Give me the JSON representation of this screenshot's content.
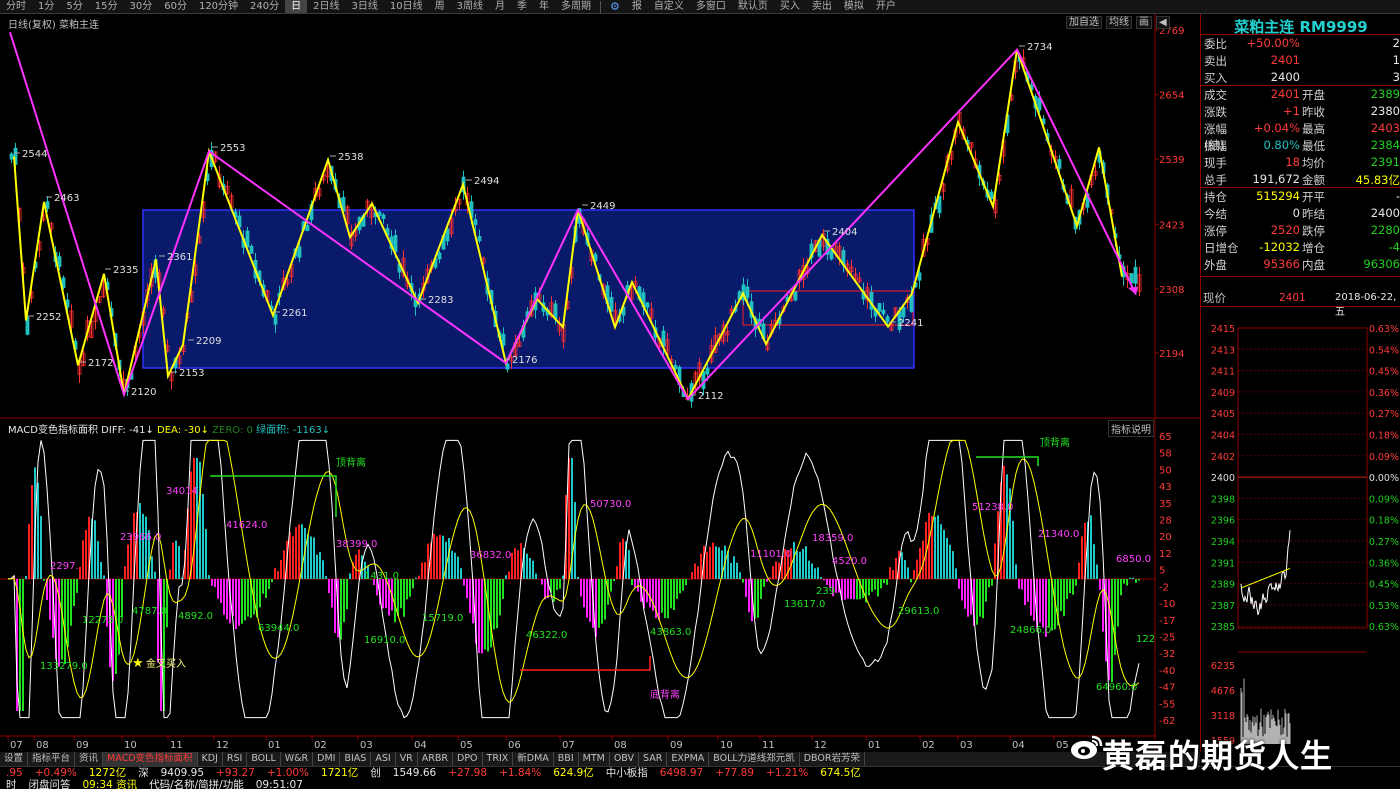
{
  "toolbar": {
    "periods": [
      "分时",
      "1分",
      "5分",
      "15分",
      "30分",
      "60分",
      "120分钟",
      "240分",
      "日",
      "2日线",
      "3日线",
      "10日线",
      "周",
      "3周线",
      "月",
      "季",
      "年",
      "多周期"
    ],
    "active_period": "日",
    "extra": [
      "报",
      "自定义",
      "多窗口",
      "默认页",
      "买入",
      "卖出",
      "模拟",
      "开户"
    ]
  },
  "main_chart": {
    "title": "日线(复权)  菜粕主连",
    "buttons": [
      "加自选",
      "均线",
      "画",
      "◀"
    ],
    "price_axis": [
      "2769",
      "2654",
      "2539",
      "2423",
      "2308",
      "2194"
    ],
    "swing_labels": [
      "2544",
      "2463",
      "2252",
      "2172",
      "2335",
      "2120",
      "2361",
      "2153",
      "2209",
      "2553",
      "2261",
      "2538",
      "2283",
      "2494",
      "2176",
      "2449",
      "2112",
      "2404",
      "2241",
      "2734"
    ],
    "colors": {
      "zigzag": "#ffff00",
      "trend": "#ff33ff",
      "box_fill": "#0a1a6a",
      "box_border": "#3030ff",
      "up": "#ff3030",
      "down": "#20c0c0"
    }
  },
  "macd": {
    "title_name": "MACD变色指标面积",
    "diff_label": "DIFF: -41",
    "dea_label": "DEA: -30",
    "zero_label": "ZERO: 0",
    "area_label": "绿面积: -1163",
    "help_button": "指标说明",
    "axis": [
      "65",
      "58",
      "50",
      "43",
      "35",
      "28",
      "20",
      "12",
      "5",
      "-2",
      "-10",
      "-17",
      "-25",
      "-32",
      "-40",
      "-47",
      "-55",
      "-62"
    ],
    "area_values_red": [
      "2297.",
      "34014.",
      "23966.0",
      "41624.0",
      "38399.0",
      "50730.0",
      "36832.0",
      "11101.0",
      "18359.0",
      "4520.0",
      "51238.0",
      "21340.0",
      "6850.0"
    ],
    "area_values_green": [
      "133279.0",
      "12273.0",
      "4787.0",
      "4892.0",
      "63944.0",
      "1431.0",
      "16910.0",
      "15719.0",
      "46322.0",
      "43863.0",
      "13617.0",
      "239",
      "29613.0",
      "24866.0",
      "64960.0",
      "122"
    ],
    "annotations": {
      "top_div_1": "顶背离",
      "top_div_2": "顶背离",
      "bottom_div": "底背离",
      "golden_cross": "金叉买入"
    }
  },
  "date_axis": [
    "07",
    "08",
    "09",
    "10",
    "11",
    "12",
    "01",
    "02",
    "03",
    "04",
    "05",
    "06",
    "07",
    "08",
    "09",
    "10",
    "11",
    "12",
    "01",
    "02",
    "03",
    "04",
    "05"
  ],
  "tabs": [
    "设置",
    "指标平台",
    "资讯",
    "MACD变色指标面积",
    "KDJ",
    "RSI",
    "BOLL",
    "W&R",
    "DMI",
    "BIAS",
    "ASI",
    "VR",
    "ARBR",
    "DPO",
    "TRIX",
    "新DMA",
    "BBI",
    "MTM",
    "OBV",
    "SAR",
    "EXPMA",
    "BOLL力道线郑元凯",
    "DBOR岩芳荣"
  ],
  "active_tab": "MACD变色指标面积",
  "statusbar": {
    "row1": [
      ".95",
      "+0.49%",
      "1272亿",
      "深",
      "9409.95",
      "+93.27",
      "+1.00%",
      "1721亿",
      "创",
      "1549.66",
      "+27.98",
      "+1.84%",
      "624.9亿",
      "中小板指",
      "6498.97",
      "+77.89",
      "+1.21%",
      "674.5亿"
    ],
    "row2": [
      "时",
      "闭盘问答",
      "09:34 资讯",
      "代码/名称/简拼/功能",
      "09:51:07"
    ]
  },
  "quote": {
    "title": "菜粕主连  RM9999",
    "rows": [
      {
        "l": "委比",
        "v": "+50.00%",
        "c": "red",
        "l2": "",
        "v2": "2",
        "c2": "wht"
      },
      {
        "l": "卖出",
        "v": "2401",
        "c": "red",
        "l2": "",
        "v2": "1",
        "c2": "wht"
      },
      {
        "l": "买入",
        "v": "2400",
        "c": "wht",
        "l2": "",
        "v2": "3",
        "c2": "wht"
      },
      {
        "l": "成交",
        "v": "2401",
        "c": "red",
        "l2": "开盘",
        "v2": "2389",
        "c2": "grn"
      },
      {
        "l": "涨跌",
        "v": "+1",
        "c": "red",
        "l2": "昨收",
        "v2": "2380",
        "c2": "wht"
      },
      {
        "l": "涨幅(结)",
        "v": "+0.04%",
        "c": "red",
        "l2": "最高",
        "v2": "2403",
        "c2": "red"
      },
      {
        "l": "振幅",
        "v": "0.80%",
        "c": "cyan",
        "l2": "最低",
        "v2": "2384",
        "c2": "grn"
      },
      {
        "l": "现手",
        "v": "18",
        "c": "red",
        "l2": "均价",
        "v2": "2391",
        "c2": "grn"
      },
      {
        "l": "总手",
        "v": "191,672",
        "c": "wht",
        "l2": "金额",
        "v2": "45.83亿",
        "c2": "yel"
      },
      {
        "l": "持仓",
        "v": "515294",
        "c": "yel",
        "l2": "开平",
        "v2": "-",
        "c2": "wht"
      },
      {
        "l": "今结",
        "v": "0",
        "c": "wht",
        "l2": "昨结",
        "v2": "2400",
        "c2": "wht"
      },
      {
        "l": "涨停",
        "v": "2520",
        "c": "red",
        "l2": "跌停",
        "v2": "2280",
        "c2": "grn"
      },
      {
        "l": "日增仓",
        "v": "-12032",
        "c": "yel",
        "l2": "增仓",
        "v2": "-4",
        "c2": "grn"
      },
      {
        "l": "外盘",
        "v": "95366",
        "c": "red",
        "l2": "内盘",
        "v2": "96306",
        "c2": "grn"
      }
    ],
    "now_label": "现价",
    "now_value": "2401",
    "now_date": "2018-06-22,五"
  },
  "minute_chart": {
    "price_axis": [
      "2415",
      "2413",
      "2411",
      "2409",
      "2405",
      "2404",
      "2402",
      "2400",
      "2398",
      "2396",
      "2394",
      "2391",
      "2389",
      "2387",
      "2385"
    ],
    "pct_axis": [
      "0.63%",
      "0.54%",
      "0.45%",
      "0.36%",
      "0.27%",
      "0.18%",
      "0.09%",
      "0.00%",
      "0.09%",
      "0.18%",
      "0.27%",
      "0.36%",
      "0.45%",
      "0.53%",
      "0.63%"
    ],
    "vol_axis": [
      "6235",
      "4676",
      "3118",
      "1559"
    ]
  },
  "watermark": "黄磊的期货人生"
}
